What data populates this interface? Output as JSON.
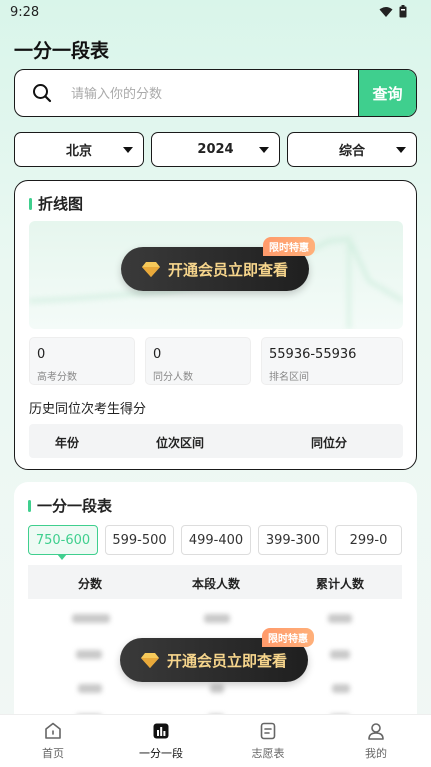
{
  "status_bar": {
    "time": "9:28"
  },
  "page": {
    "title": "一分一段表"
  },
  "search": {
    "placeholder": "请输入你的分数",
    "value": "",
    "button_label": "查询"
  },
  "filters": [
    {
      "value": "北京"
    },
    {
      "value": "2024"
    },
    {
      "value": "综合"
    }
  ],
  "line_chart_section": {
    "title": "折线图",
    "vip_button": "开通会员立即查看",
    "promo_tag": "限时特惠",
    "stats": [
      {
        "value": "0",
        "label": "高考分数"
      },
      {
        "value": "0",
        "label": "同分人数"
      },
      {
        "value": "55936-55936",
        "label": "排名区间"
      }
    ],
    "history_label": "历史同位次考生得分",
    "history_headers": [
      "年份",
      "位次区间",
      "同位分"
    ]
  },
  "table_section": {
    "title": "一分一段表",
    "ranges": [
      "750-600",
      "599-500",
      "499-400",
      "399-300",
      "299-0"
    ],
    "active_range": "750-600",
    "headers": [
      "分数",
      "本段人数",
      "累计人数"
    ],
    "vip_button": "开通会员立即查看",
    "promo_tag": "限时特惠"
  },
  "bottom_nav": {
    "items": [
      {
        "label": "首页",
        "icon": "home-icon"
      },
      {
        "label": "一分一段",
        "icon": "chart-icon"
      },
      {
        "label": "志愿表",
        "icon": "form-icon"
      },
      {
        "label": "我的",
        "icon": "user-icon"
      }
    ],
    "active": "一分一段"
  },
  "colors": {
    "accent": "#3fcf8e",
    "vip_text": "#f6d58c",
    "promo": "#ff9a6b"
  }
}
